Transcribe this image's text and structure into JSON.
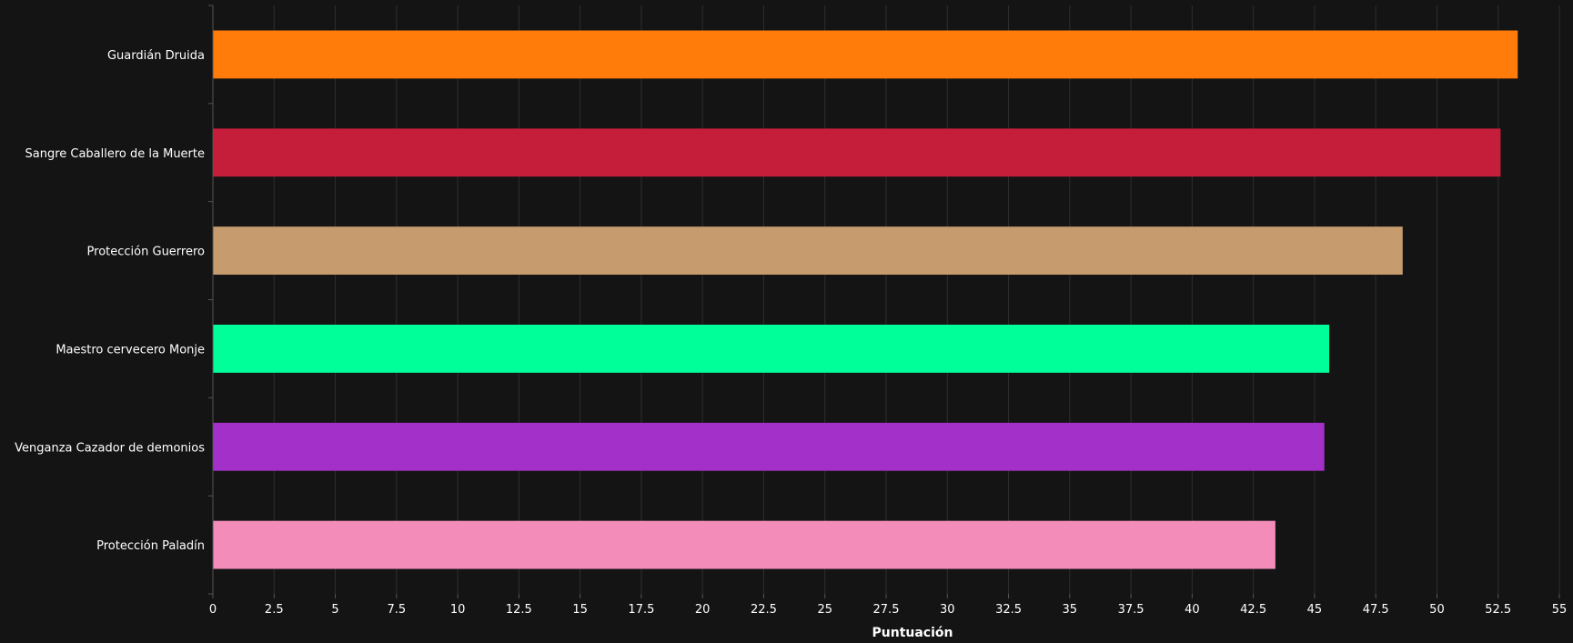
{
  "chart_data": {
    "type": "bar",
    "orientation": "horizontal",
    "categories": [
      "Guardián Druida",
      "Sangre Caballero de la Muerte",
      "Protección Guerrero",
      "Maestro cervecero Monje",
      "Venganza Cazador de demonios",
      "Protección Paladín"
    ],
    "values": [
      53.3,
      52.6,
      48.6,
      45.6,
      45.4,
      43.4
    ],
    "colors": [
      "#ff7c0a",
      "#c41e3a",
      "#c69b6d",
      "#00ff98",
      "#a330c9",
      "#f48cba"
    ],
    "xlabel": "Puntuación",
    "ylabel": "",
    "xlim": [
      0,
      55
    ],
    "xticks": [
      "0",
      "2.5",
      "5",
      "7.5",
      "10",
      "12.5",
      "15",
      "17.5",
      "20",
      "22.5",
      "25",
      "27.5",
      "30",
      "32.5",
      "35",
      "37.5",
      "40",
      "42.5",
      "45",
      "47.5",
      "50",
      "52.5",
      "55"
    ],
    "grid": true,
    "background": "#141414"
  }
}
